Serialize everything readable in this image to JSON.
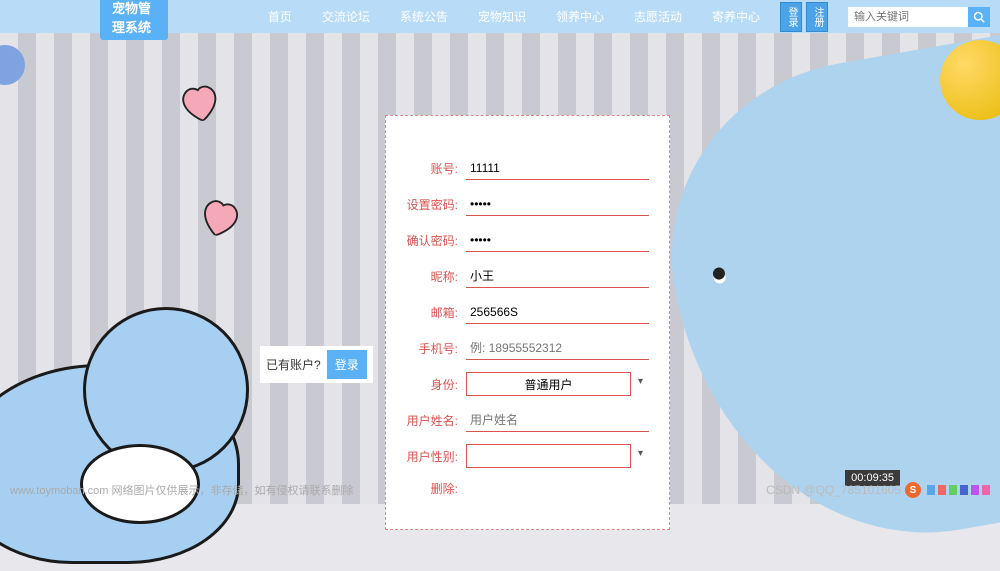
{
  "header": {
    "brand": "宠物管理系统",
    "nav": [
      "首页",
      "交流论坛",
      "系统公告",
      "宠物知识",
      "领养中心",
      "志愿活动",
      "寄养中心"
    ],
    "auth": {
      "login": "登录",
      "register": "注册"
    },
    "search": {
      "placeholder": "输入关键词"
    }
  },
  "form": {
    "fields": {
      "username": {
        "label": "账号:",
        "value": "11111"
      },
      "password": {
        "label": "设置密码:",
        "value": "•••••"
      },
      "confirm": {
        "label": "确认密码:",
        "value": "•••••"
      },
      "nickname": {
        "label": "昵称:",
        "value": "小王"
      },
      "email": {
        "label": "邮箱:",
        "value": "256566S"
      },
      "phone": {
        "label": "手机号:",
        "placeholder": "例: 18955552312",
        "value": ""
      },
      "role": {
        "label": "身份:",
        "value": "普通用户"
      },
      "realname": {
        "label": "用户姓名:",
        "placeholder": "用户姓名",
        "value": ""
      },
      "gender": {
        "label": "用户性别:",
        "value": ""
      },
      "delete": {
        "label": "删除:"
      }
    }
  },
  "login_hint": {
    "text": "已有账户?",
    "button": "登录"
  },
  "timer": "00:09:35",
  "watermark_left": "www.toymoban.com  网络图片仅供展示，非存储，如有侵权请联系删除",
  "watermark_right": "CSDN @QQ_785101605"
}
